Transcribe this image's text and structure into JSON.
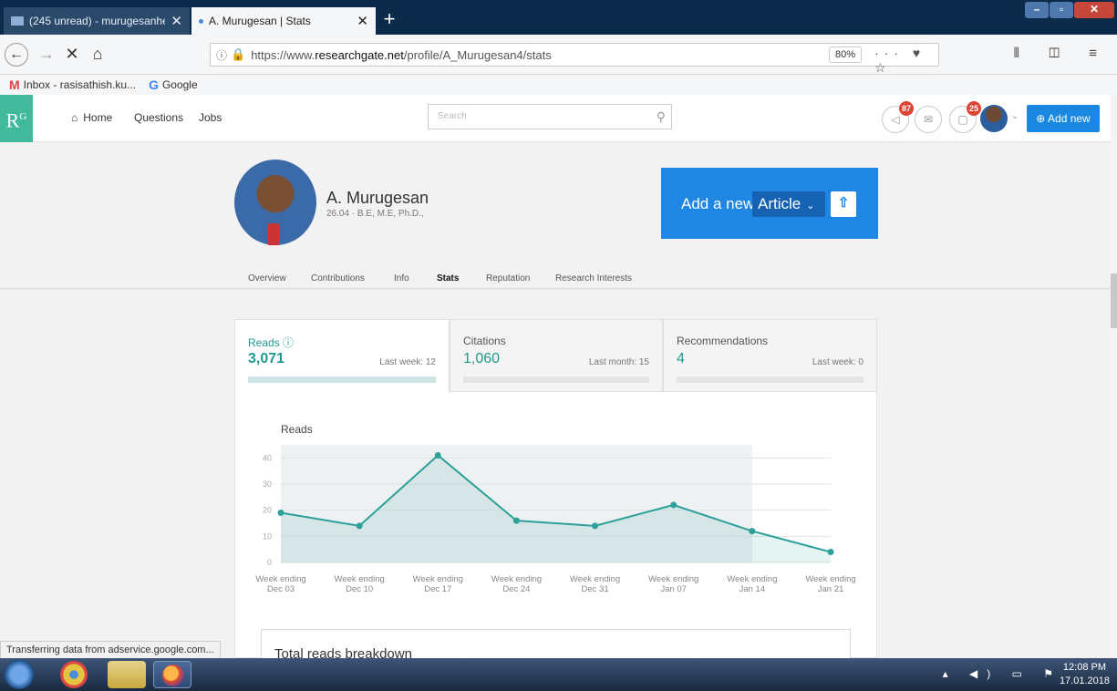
{
  "browser": {
    "tabs": [
      {
        "title": "(245 unread) - murugesanhem",
        "close": "✕"
      },
      {
        "title": "A. Murugesan | Stats",
        "close": "✕"
      }
    ],
    "new_tab": "+",
    "url_prefix": "https://www.",
    "url_host": "researchgate.net",
    "url_rest": "/profile/A_Murugesan4/stats",
    "zoom": "80%",
    "bookmarks": [
      {
        "label": "Inbox - rasisathish.ku..."
      },
      {
        "label": "Google"
      }
    ],
    "status_text": "Transferring data from adservice.google.com..."
  },
  "rg_header": {
    "logo": "R",
    "logo_sup": "G",
    "nav": [
      "Home",
      "Questions",
      "Jobs"
    ],
    "search_placeholder": "Search",
    "badge_notifications": "87",
    "badge_messages": "25",
    "add_new": "Add new"
  },
  "profile": {
    "name": "A. Murugesan",
    "meta": "26.04 · B.E, M.E, Ph.D.,",
    "add_new_label": "Add a new",
    "add_new_select": "Article",
    "tabs": [
      "Overview",
      "Contributions",
      "Info",
      "Stats",
      "Reputation",
      "Research Interests"
    ],
    "active_tab": "Stats"
  },
  "stats": {
    "cards": [
      {
        "title": "Reads",
        "value": "3,071",
        "sub": "Last week: 12"
      },
      {
        "title": "Citations",
        "value": "1,060",
        "sub": "Last month: 15"
      },
      {
        "title": "Recommendations",
        "value": "4",
        "sub": "Last week: 0"
      }
    ],
    "breakdown_title": "Total reads breakdown"
  },
  "chart_data": {
    "type": "area",
    "title": "Reads",
    "categories": [
      [
        "Week ending",
        "Dec 03"
      ],
      [
        "Week ending",
        "Dec 10"
      ],
      [
        "Week ending",
        "Dec 17"
      ],
      [
        "Week ending",
        "Dec 24"
      ],
      [
        "Week ending",
        "Dec 31"
      ],
      [
        "Week ending",
        "Jan 07"
      ],
      [
        "Week ending",
        "Jan 14"
      ],
      [
        "Week ending",
        "Jan 21"
      ]
    ],
    "values": [
      19,
      14,
      41,
      16,
      14,
      22,
      12,
      4
    ],
    "yticks": [
      0,
      10,
      20,
      30,
      40
    ],
    "ylim": [
      0,
      45
    ],
    "color": "#2ca09a"
  },
  "taskbar": {
    "time": "12:08 PM",
    "date": "17.01.2018"
  }
}
